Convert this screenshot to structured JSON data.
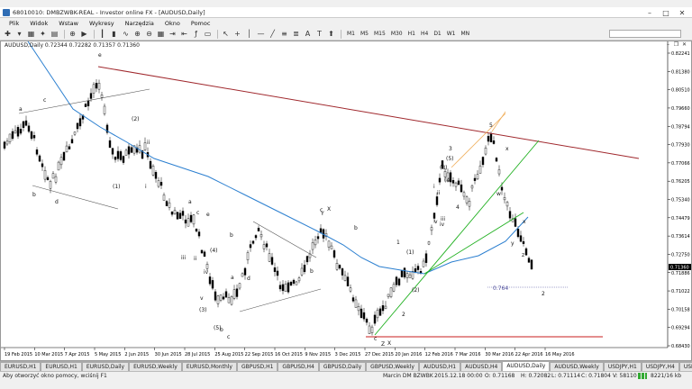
{
  "window": {
    "title": "68010010: DMBZWBK-REAL - Investor online FX - [AUDUSD,Daily]"
  },
  "menu": [
    "Plik",
    "Widok",
    "Wstaw",
    "Wykresy",
    "Narzędzia",
    "Okno",
    "Pomoc"
  ],
  "toolbar": {
    "timeframes": [
      "M1",
      "M5",
      "M15",
      "M30",
      "H1",
      "H4",
      "D1",
      "W1",
      "MN"
    ]
  },
  "chart": {
    "header": "AUDUSD,Daily  0.72344 0.72282 0.71357 0.71360",
    "current_price": "0.71360",
    "fib_label": "0.764",
    "price_ticks": [
      "0.82241",
      "0.81380",
      "0.80510",
      "0.79660",
      "0.78794",
      "0.77930",
      "0.77066",
      "0.76205",
      "0.75340",
      "0.74479",
      "0.73614",
      "0.72750",
      "0.71886",
      "0.71022",
      "0.70158",
      "0.69294",
      "0.68430"
    ],
    "date_ticks": [
      "19 Feb 2015",
      "10 Mar 2015",
      "7 Apr 2015",
      "5 May 2015",
      "2 Jun 2015",
      "30 Jun 2015",
      "28 Jul 2015",
      "25 Aug 2015",
      "22 Sep 2015",
      "16 Oct 2015",
      "9 Nov 2015",
      "3 Dec 2015",
      "27 Dec 2015",
      "20 Jan 2016",
      "12 Feb 2016",
      "7 Mar 2016",
      "30 Mar 2016",
      "22 Apr 2016",
      "16 May 2016"
    ],
    "wave_labels": [
      "a",
      "c",
      "e",
      "b",
      "d",
      "(2)",
      "(1)",
      "ii",
      "i",
      "a",
      "c",
      "e",
      "ii",
      "(4)",
      "b",
      "d",
      "iii",
      "v",
      "iv",
      "(3)",
      "(5)",
      "b",
      "c",
      "Y",
      "a",
      "b",
      "c",
      "X",
      "b",
      "1",
      "(1)",
      "(2)",
      "2",
      "c",
      "Z",
      "X",
      "i",
      "ii",
      "iii",
      "iv",
      "v",
      "3",
      "(5)",
      "(3)",
      "(4)",
      "4",
      "5",
      "x",
      "w",
      "x",
      "y",
      "z",
      "2"
    ]
  },
  "tabs": [
    "EURUSD,H1",
    "EURUSD,H1",
    "EURUSD,Daily",
    "EURUSD,Weekly",
    "EURUSD,Monthly",
    "GBPUSD,H1",
    "GBPUSD,H4",
    "GBPUSD,Daily",
    "GBPUSD,Weekly",
    "AUDUSD,H1",
    "AUDUSD,H4",
    "AUDUSD,Daily",
    "AUDUSD,Weekly",
    "USDJPY,H1",
    "USDJPY,H4",
    "USDJPY,Daily"
  ],
  "active_tab_index": 11,
  "status": {
    "help": "Aby otworzyć okno pomocy, wciśnij F1",
    "profile": "Marcin DM BZWBK",
    "datetime": "2015.12.18 00:00",
    "open": "O: 0.71168",
    "high": "H: 0.72082",
    "low": "L: 0.71114",
    "close": "C: 0.71804",
    "volume": "V: 58110",
    "traffic": "8221/16 kb"
  },
  "colors": {
    "resistance_line": "#a0282d",
    "moving_average": "#2b7fd0",
    "uptrend_line": "#20b020",
    "support_line": "#c81e1e",
    "orange_channel": "#f0b060"
  }
}
